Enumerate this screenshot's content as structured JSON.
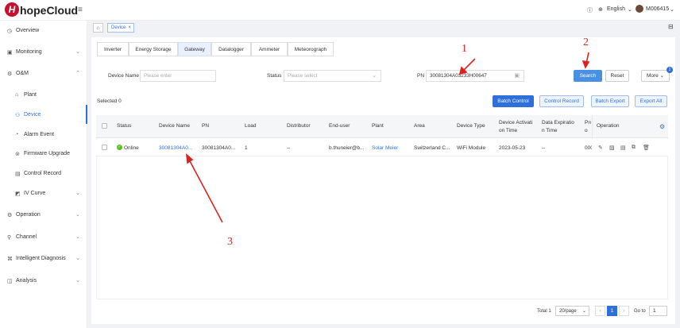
{
  "brand": {
    "logo_letter": "H",
    "name": "hopeCloud"
  },
  "header": {
    "language": "English",
    "user": "M006415"
  },
  "sidebar": {
    "items": [
      {
        "label": "Overview",
        "icon": "overview-icon"
      },
      {
        "label": "Monitoring",
        "icon": "monitor-icon"
      },
      {
        "label": "O&M",
        "icon": "om-icon"
      },
      {
        "label": "Plant",
        "icon": "plant-icon"
      },
      {
        "label": "Device",
        "icon": "device-icon"
      },
      {
        "label": "Alarm Event",
        "icon": "alarm-icon"
      },
      {
        "label": "Firmware Upgrade",
        "icon": "firmware-icon"
      },
      {
        "label": "Control Record",
        "icon": "record-icon"
      },
      {
        "label": "IV Curve",
        "icon": "curve-icon"
      },
      {
        "label": "Operation",
        "icon": "operation-icon"
      },
      {
        "label": "Channel",
        "icon": "channel-icon"
      },
      {
        "label": "Intelligent Diagnosis",
        "icon": "diagnosis-icon"
      },
      {
        "label": "Analysis",
        "icon": "analysis-icon"
      }
    ]
  },
  "breadcrumb": {
    "tag": "Device"
  },
  "tabs": [
    "Inverter",
    "Energy Storage",
    "Gateway",
    "Datalogger",
    "Ammeter",
    "Meteorograph"
  ],
  "filters": {
    "device_name_label": "Device Name",
    "device_name_placeholder": "Please enter",
    "status_label": "Status",
    "status_placeholder": "Please select",
    "pn_label": "PN",
    "pn_value": "30081304A03233H00647"
  },
  "buttons": {
    "search": "Search",
    "reset": "Reset",
    "more": "More",
    "more_badge": "1",
    "batch_control": "Batch Control",
    "control_record": "Control Record",
    "batch_export": "Batch Export",
    "export_all": "Export All"
  },
  "selected_text": "Selected 0",
  "table": {
    "headers": [
      "Status",
      "Device Name",
      "PN",
      "Load",
      "Distributor",
      "End-user",
      "Plant",
      "Area",
      "Device Type",
      "Device Activati on Time",
      "Data Expiratio n Time",
      "Pro o",
      "Operation"
    ],
    "row": {
      "status": "Online",
      "device_name": "30081304A0...",
      "pn": "30081304A0...",
      "load": "1",
      "distributor": "--",
      "end_user": "b.thuneier@b...",
      "plant": "Solar Meier",
      "area": "Switzerland C...",
      "device_type": "WiFi Module",
      "activation": "2023-05-23",
      "expiration": "--",
      "pro": "000"
    }
  },
  "pagination": {
    "total": "Total 1",
    "page_size": "20/page",
    "current": "1",
    "goto_label": "Go to",
    "goto_value": "1"
  },
  "annotations": {
    "n1": "1",
    "n2": "2",
    "n3": "3"
  }
}
